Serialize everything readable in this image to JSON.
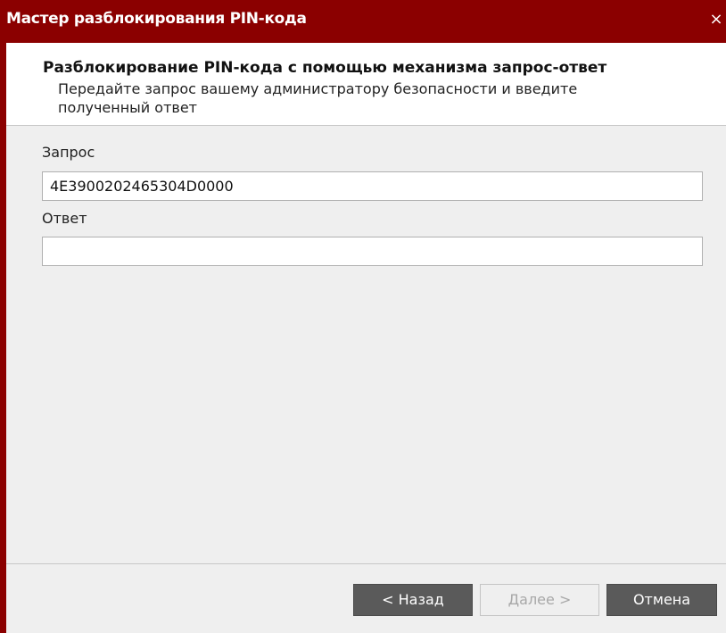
{
  "window": {
    "title": "Мастер разблокирования PIN-кода",
    "close_glyph": "×"
  },
  "header": {
    "title": "Разблокирование PIN-кода с помощью механизма запрос-ответ",
    "description": "Передайте запрос вашему администратору безопасности и введите полученный ответ"
  },
  "form": {
    "request_label": "Запрос",
    "request_value": "4E390020246530​4D0000",
    "response_label": "Ответ",
    "response_value": ""
  },
  "buttons": {
    "back_label": "< Назад",
    "next_label": "Далее >",
    "cancel_label": "Отмена"
  },
  "colors": {
    "titlebar": "#8b0000",
    "button_dark": "#5a5a5a"
  }
}
